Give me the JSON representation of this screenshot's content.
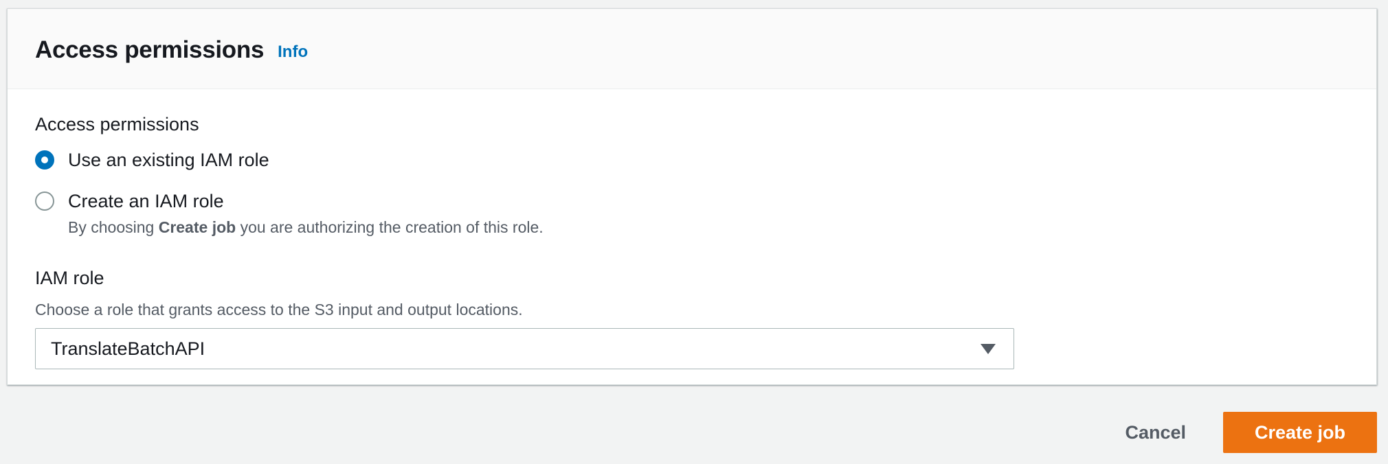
{
  "panel": {
    "title": "Access permissions",
    "info_link": "Info"
  },
  "access": {
    "group_label": "Access permissions",
    "options": [
      {
        "label": "Use an existing IAM role",
        "checked": true
      },
      {
        "label": "Create an IAM role",
        "checked": false,
        "description_prefix": "By choosing ",
        "description_bold": "Create job",
        "description_suffix": " you are authorizing the creation of this role."
      }
    ]
  },
  "iam_role": {
    "label": "IAM role",
    "description": "Choose a role that grants access to the S3 input and output locations.",
    "selected": "TranslateBatchAPI"
  },
  "actions": {
    "cancel_label": "Cancel",
    "create_label": "Create job"
  },
  "colors": {
    "accent": "#0073bb",
    "primary_button": "#ec7211",
    "background": "#f2f3f3"
  },
  "icons": {
    "select_caret": "caret-down-icon",
    "radio_selected": "radio-checked-icon",
    "radio_unselected": "radio-unchecked-icon"
  }
}
